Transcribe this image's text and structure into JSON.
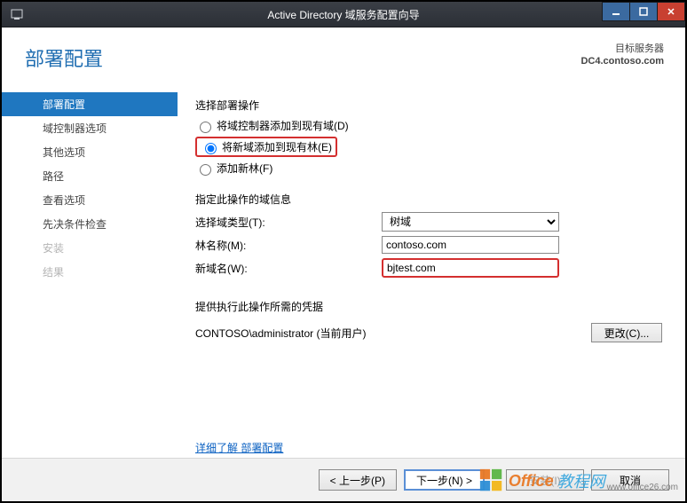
{
  "window": {
    "title": "Active Directory 域服务配置向导"
  },
  "header": {
    "title": "部署配置",
    "target_label": "目标服务器",
    "target_value": "DC4.contoso.com"
  },
  "sidebar": {
    "items": [
      {
        "label": "部署配置",
        "state": "active"
      },
      {
        "label": "域控制器选项",
        "state": "normal"
      },
      {
        "label": "其他选项",
        "state": "normal"
      },
      {
        "label": "路径",
        "state": "normal"
      },
      {
        "label": "查看选项",
        "state": "normal"
      },
      {
        "label": "先决条件检查",
        "state": "normal"
      },
      {
        "label": "安装",
        "state": "disabled"
      },
      {
        "label": "结果",
        "state": "disabled"
      }
    ]
  },
  "main": {
    "op_label": "选择部署操作",
    "radios": {
      "r1": "将域控制器添加到现有域(D)",
      "r2": "将新域添加到现有林(E)",
      "r3": "添加新林(F)"
    },
    "info_label": "指定此操作的域信息",
    "domain_type_label": "选择域类型(T):",
    "domain_type_value": "树域",
    "forest_name_label": "林名称(M):",
    "forest_name_value": "contoso.com",
    "new_domain_label": "新域名(W):",
    "new_domain_value": "bjtest.com",
    "creds_label": "提供执行此操作所需的凭据",
    "creds_value": "CONTOSO\\administrator (当前用户)",
    "change_button": "更改(C)...",
    "link": "详细了解 部署配置"
  },
  "footer": {
    "back": "< 上一步(P)",
    "next": "下一步(N) >",
    "install": "安装(I)",
    "cancel": "取消"
  },
  "watermark": {
    "text1": "Office",
    "text2": "教程网",
    "url": "www.office26.com"
  }
}
